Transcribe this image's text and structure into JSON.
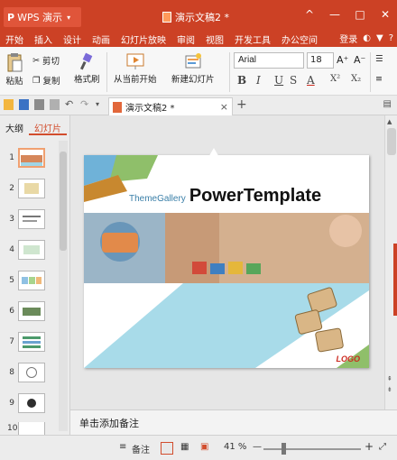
{
  "titlebar": {
    "app_name": "WPS 演示",
    "doc_title": "演示文稿2 *",
    "controls": {
      "up": "^",
      "minimize": "—",
      "maximize": "□",
      "close": "✕"
    }
  },
  "menu": {
    "items": [
      "开始",
      "插入",
      "设计",
      "动画",
      "幻灯片放映",
      "审阅",
      "视图",
      "开发工具",
      "办公空间"
    ],
    "right": {
      "login": "登录",
      "help": "?"
    }
  },
  "ribbon": {
    "paste_label": "粘贴",
    "cut_label": "剪切",
    "copy_label": "复制",
    "format_painter_label": "格式刷",
    "from_current_label": "从当前开始",
    "new_slide_label": "新建幻灯片",
    "font_name": "Arial",
    "font_size": "18",
    "grow_font": "A⁺",
    "shrink_font": "A⁻",
    "bold": "B",
    "italic": "I",
    "underline": "U",
    "strike": "S",
    "font_color": "A",
    "superscript": "X²",
    "subscript": "X₂"
  },
  "tabs": {
    "doc_tab": "演示文稿2 *",
    "add": "+",
    "close": "×"
  },
  "left_panel": {
    "tabs": [
      "大纲",
      "幻灯片"
    ],
    "active_tab": "幻灯片",
    "slide_numbers": [
      "1",
      "2",
      "3",
      "4",
      "5",
      "6",
      "7",
      "8",
      "9",
      "10"
    ]
  },
  "slide": {
    "theme_gallery": "ThemeGallery",
    "title": "PowerTemplate",
    "logo": "LOGO"
  },
  "notes": {
    "placeholder": "单击添加备注"
  },
  "status": {
    "notes_label": "备注",
    "zoom": "41 %",
    "zoom_out": "—",
    "zoom_in": "+"
  },
  "colors": {
    "brand": "#cc4125",
    "accent_tab": "#d24d2d",
    "logo": "#cc2a1f"
  }
}
